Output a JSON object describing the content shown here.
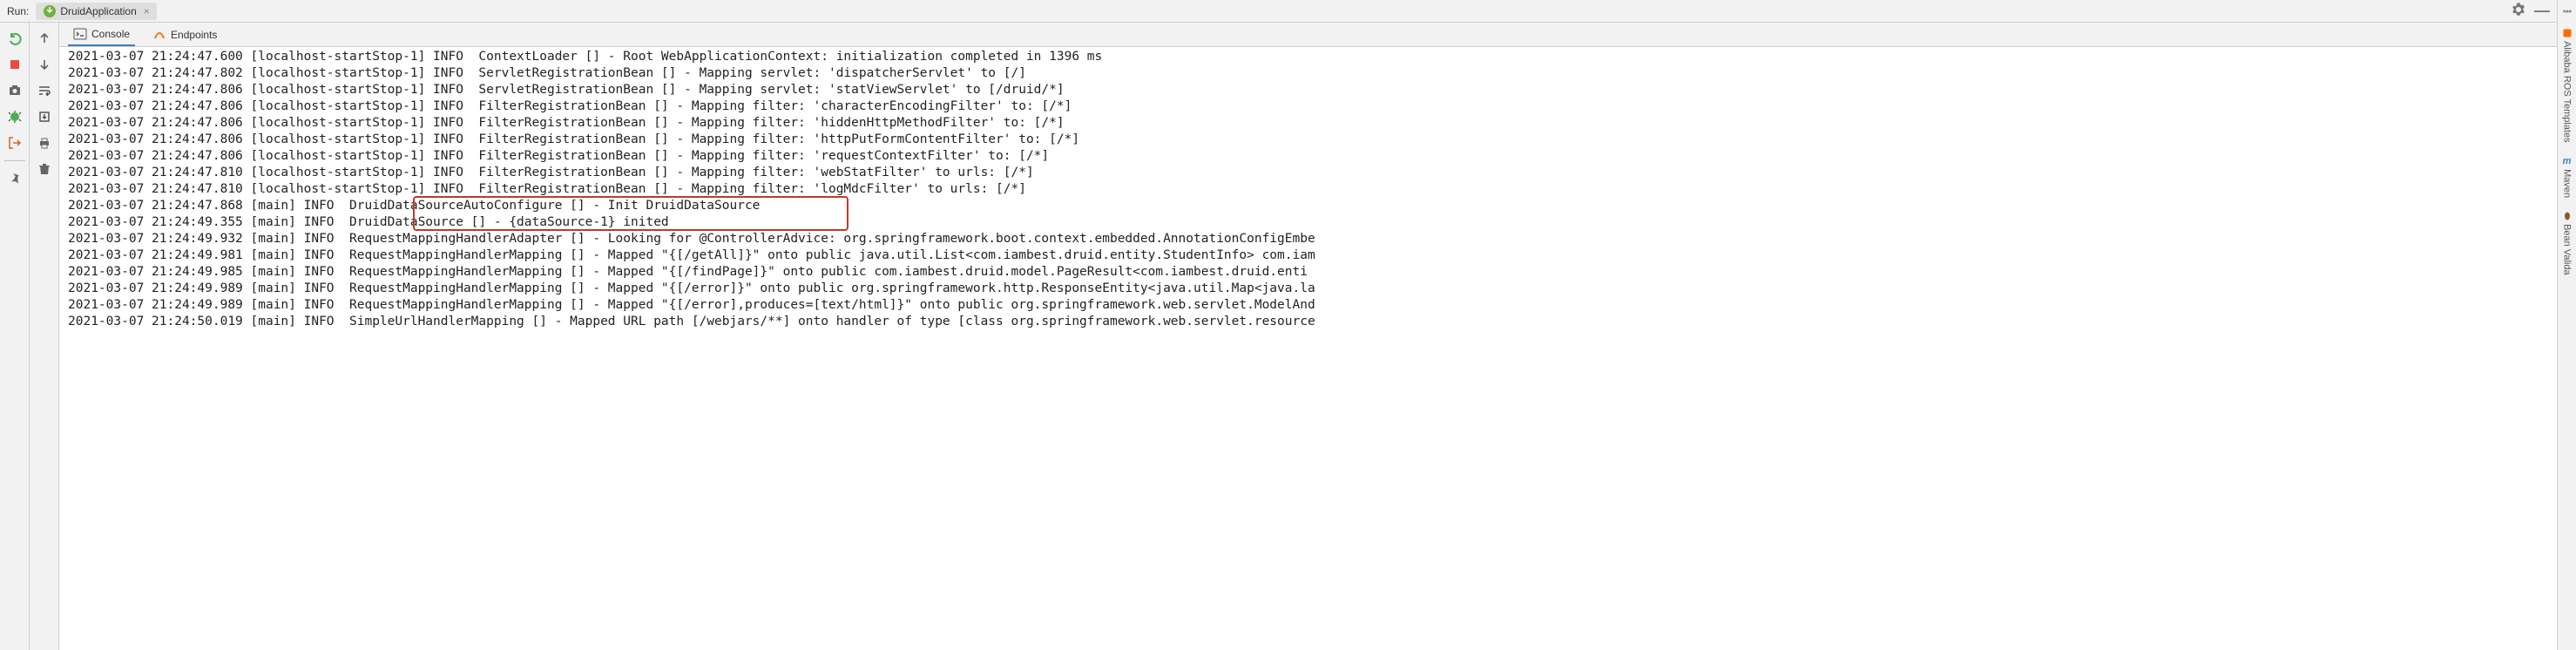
{
  "header": {
    "run_label": "Run:",
    "run_config": "DruidApplication"
  },
  "tabs": {
    "console": "Console",
    "endpoints": "Endpoints"
  },
  "console": {
    "lines": [
      "2021-03-07 21:24:47.600 [localhost-startStop-1] INFO  ContextLoader [] - Root WebApplicationContext: initialization completed in 1396 ms",
      "2021-03-07 21:24:47.802 [localhost-startStop-1] INFO  ServletRegistrationBean [] - Mapping servlet: 'dispatcherServlet' to [/]",
      "2021-03-07 21:24:47.806 [localhost-startStop-1] INFO  ServletRegistrationBean [] - Mapping servlet: 'statViewServlet' to [/druid/*]",
      "2021-03-07 21:24:47.806 [localhost-startStop-1] INFO  FilterRegistrationBean [] - Mapping filter: 'characterEncodingFilter' to: [/*]",
      "2021-03-07 21:24:47.806 [localhost-startStop-1] INFO  FilterRegistrationBean [] - Mapping filter: 'hiddenHttpMethodFilter' to: [/*]",
      "2021-03-07 21:24:47.806 [localhost-startStop-1] INFO  FilterRegistrationBean [] - Mapping filter: 'httpPutFormContentFilter' to: [/*]",
      "2021-03-07 21:24:47.806 [localhost-startStop-1] INFO  FilterRegistrationBean [] - Mapping filter: 'requestContextFilter' to: [/*]",
      "2021-03-07 21:24:47.810 [localhost-startStop-1] INFO  FilterRegistrationBean [] - Mapping filter: 'webStatFilter' to urls: [/*]",
      "2021-03-07 21:24:47.810 [localhost-startStop-1] INFO  FilterRegistrationBean [] - Mapping filter: 'logMdcFilter' to urls: [/*]",
      "2021-03-07 21:24:47.868 [main] INFO  DruidDataSourceAutoConfigure [] - Init DruidDataSource",
      "2021-03-07 21:24:49.355 [main] INFO  DruidDataSource [] - {dataSource-1} inited",
      "2021-03-07 21:24:49.932 [main] INFO  RequestMappingHandlerAdapter [] - Looking for @ControllerAdvice: org.springframework.boot.context.embedded.AnnotationConfigEmbe",
      "2021-03-07 21:24:49.981 [main] INFO  RequestMappingHandlerMapping [] - Mapped \"{[/getAll]}\" onto public java.util.List<com.iambest.druid.entity.StudentInfo> com.iam",
      "2021-03-07 21:24:49.985 [main] INFO  RequestMappingHandlerMapping [] - Mapped \"{[/findPage]}\" onto public com.iambest.druid.model.PageResult<com.iambest.druid.enti",
      "2021-03-07 21:24:49.989 [main] INFO  RequestMappingHandlerMapping [] - Mapped \"{[/error]}\" onto public org.springframework.http.ResponseEntity<java.util.Map<java.la",
      "2021-03-07 21:24:49.989 [main] INFO  RequestMappingHandlerMapping [] - Mapped \"{[/error],produces=[text/html]}\" onto public org.springframework.web.servlet.ModelAnd",
      "2021-03-07 21:24:50.019 [main] INFO  SimpleUrlHandlerMapping [] - Mapped URL path [/webjars/**] onto handler of type [class org.springframework.web.servlet.resource"
    ]
  },
  "right_sidebar": {
    "alibaba": "Alibaba ROS Templates",
    "maven": "Maven",
    "bean": "Bean Valida"
  }
}
